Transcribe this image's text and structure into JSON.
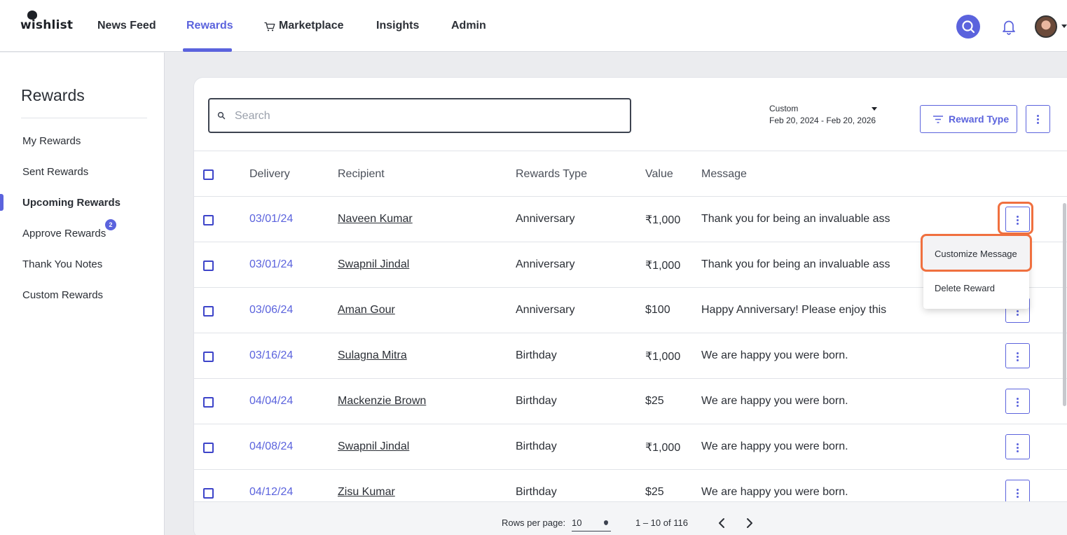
{
  "brand": {
    "name": "wishlist",
    "accent": "#5b63dd",
    "highlight": "#f0703f"
  },
  "nav": {
    "items": [
      {
        "label": "News Feed"
      },
      {
        "label": "Rewards",
        "active": true
      },
      {
        "label": "Marketplace",
        "icon": "cart-icon"
      },
      {
        "label": "Insights"
      },
      {
        "label": "Admin"
      }
    ],
    "icons": [
      "search-icon",
      "bell-icon",
      "avatar"
    ]
  },
  "sidebar": {
    "title": "Rewards",
    "items": [
      {
        "label": "My Rewards"
      },
      {
        "label": "Sent Rewards"
      },
      {
        "label": "Upcoming Rewards",
        "active": true
      },
      {
        "label": "Approve Rewards",
        "badge": "2"
      },
      {
        "label": "Thank You Notes"
      },
      {
        "label": "Custom Rewards"
      }
    ]
  },
  "toolbar": {
    "search_placeholder": "Search",
    "date_label": "Custom",
    "date_range": "Feb 20, 2024 - Feb 20, 2026",
    "reward_type_label": "Reward Type"
  },
  "table": {
    "columns": [
      "Delivery",
      "Recipient",
      "Rewards Type",
      "Value",
      "Message"
    ],
    "rows": [
      {
        "delivery": "03/01/24",
        "recipient": "Naveen Kumar",
        "type": "Anniversary",
        "value": "₹1,000",
        "message": "Thank you for being an invaluable ass"
      },
      {
        "delivery": "03/01/24",
        "recipient": "Swapnil Jindal",
        "type": "Anniversary",
        "value": "₹1,000",
        "message": "Thank you for being an invaluable ass"
      },
      {
        "delivery": "03/06/24",
        "recipient": "Aman Gour",
        "type": "Anniversary",
        "value": "$100",
        "message": "Happy Anniversary! Please enjoy this"
      },
      {
        "delivery": "03/16/24",
        "recipient": "Sulagna Mitra",
        "type": "Birthday",
        "value": "₹1,000",
        "message": "We are happy you were born."
      },
      {
        "delivery": "04/04/24",
        "recipient": "Mackenzie Brown",
        "type": "Birthday",
        "value": "$25",
        "message": "We are happy you were born."
      },
      {
        "delivery": "04/08/24",
        "recipient": "Swapnil Jindal",
        "type": "Birthday",
        "value": "₹1,000",
        "message": "We are happy you were born."
      },
      {
        "delivery": "04/12/24",
        "recipient": "Zisu Kumar",
        "type": "Birthday",
        "value": "$25",
        "message": "We are happy you were born."
      }
    ]
  },
  "menu": {
    "items": [
      "Customize Message",
      "Delete Reward"
    ]
  },
  "pagination": {
    "rows_label": "Rows per page:",
    "rows_value": "10",
    "range": "1 – 10 of 116"
  }
}
